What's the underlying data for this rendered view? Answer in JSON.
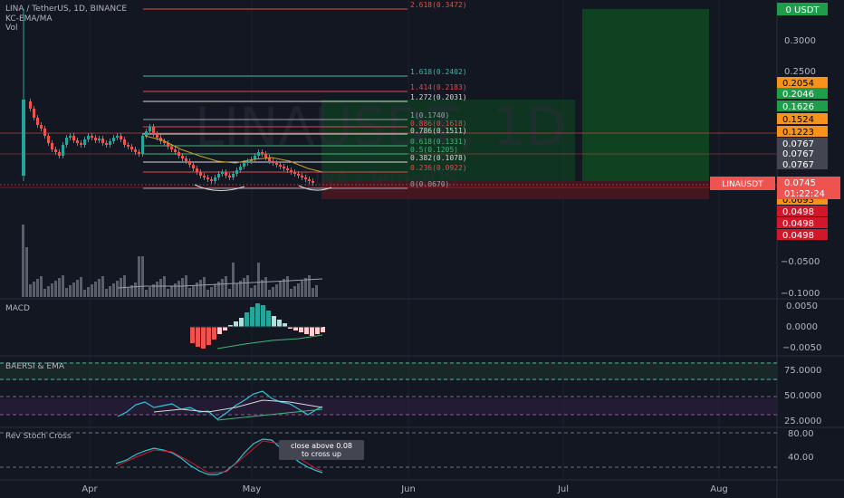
{
  "header": {
    "symbol_line": "LINA / TetherUS, 1D, BINANCE",
    "indicator_1": "KC-EMA/MA",
    "indicator_2": "Vol"
  },
  "watermark": {
    "main": "LINAUSDT, 1D",
    "sub": "LINA / TetherUS"
  },
  "fib_levels": [
    {
      "label": "2.618(0.3472)",
      "color": "#e0533f"
    },
    {
      "label": "1.618(0.2402)",
      "color": "#3fb8a8"
    },
    {
      "label": "1.414(0.2183)",
      "color": "#e04a4a"
    },
    {
      "label": "1.272(0.2031)",
      "color": "#d8d8d8"
    },
    {
      "label": "1(0.1740)",
      "color": "#9aa0a6"
    },
    {
      "label": "0.886(0.1618)",
      "color": "#e04a4a"
    },
    {
      "label": "0.786(0.1511)",
      "color": "#d8d8d8"
    },
    {
      "label": "0.618(0.1331)",
      "color": "#3fb878"
    },
    {
      "label": "0.5(0.1205)",
      "color": "#3fb878"
    },
    {
      "label": "0.382(0.1078)",
      "color": "#d8d8d8"
    },
    {
      "label": "0.236(0.0922)",
      "color": "#e04a4a"
    },
    {
      "label": "0(0.0670)",
      "color": "#9aa0a6"
    }
  ],
  "price_axis": {
    "ticks": [
      "0.3000",
      "0.2500",
      "−0.0500",
      "−0.1000"
    ],
    "top_badge": "0 USDT",
    "badges": [
      {
        "text": "0.2054",
        "bg": "#f7931a",
        "fg": "#000000"
      },
      {
        "text": "0.2046",
        "bg": "#1e9e4a",
        "fg": "#ffffff"
      },
      {
        "text": "0.1626",
        "bg": "#1e9e4a",
        "fg": "#ffffff"
      },
      {
        "text": "0.1524",
        "bg": "#f7931a",
        "fg": "#000000"
      },
      {
        "text": "0.1223",
        "bg": "#f7931a",
        "fg": "#000000"
      },
      {
        "text": "0.0767",
        "bg": "#434651",
        "fg": "#ffffff"
      },
      {
        "text": "0.0767",
        "bg": "#434651",
        "fg": "#ffffff"
      },
      {
        "text": "0.0767",
        "bg": "#434651",
        "fg": "#ffffff"
      },
      {
        "text": "0.0693",
        "bg": "#f7931a",
        "fg": "#000000"
      },
      {
        "text": "0.0498",
        "bg": "#d1182b",
        "fg": "#ffffff"
      },
      {
        "text": "0.0498",
        "bg": "#d1182b",
        "fg": "#ffffff"
      },
      {
        "text": "0.0498",
        "bg": "#d1182b",
        "fg": "#ffffff"
      }
    ],
    "symbol_tag": "LINAUSDT",
    "last_price": "0.0745",
    "countdown": "01:22:24"
  },
  "macd_pane": {
    "title": "MACD",
    "ticks": [
      "0.0050",
      "0.0000",
      "−0.0050"
    ]
  },
  "rsi_pane": {
    "title": "BAERSI & EMA",
    "ticks": [
      "75.0000",
      "50.0000",
      "25.0000"
    ]
  },
  "stoch_pane": {
    "title": "Rev Stoch Cross",
    "ticks": [
      "80.00",
      "40.00"
    ],
    "note_line1": "close above 0.08",
    "note_line2": "to cross up"
  },
  "time_axis": {
    "labels": [
      "Apr",
      "May",
      "Jun",
      "Jul",
      "Aug"
    ]
  },
  "colors": {
    "bg": "#131722",
    "up": "#26a69a",
    "down": "#ef5350",
    "grid": "#1e222d",
    "text": "#b2b5be",
    "long_profit": "#0f5a2a",
    "long_loss": "#5a1a22"
  }
}
